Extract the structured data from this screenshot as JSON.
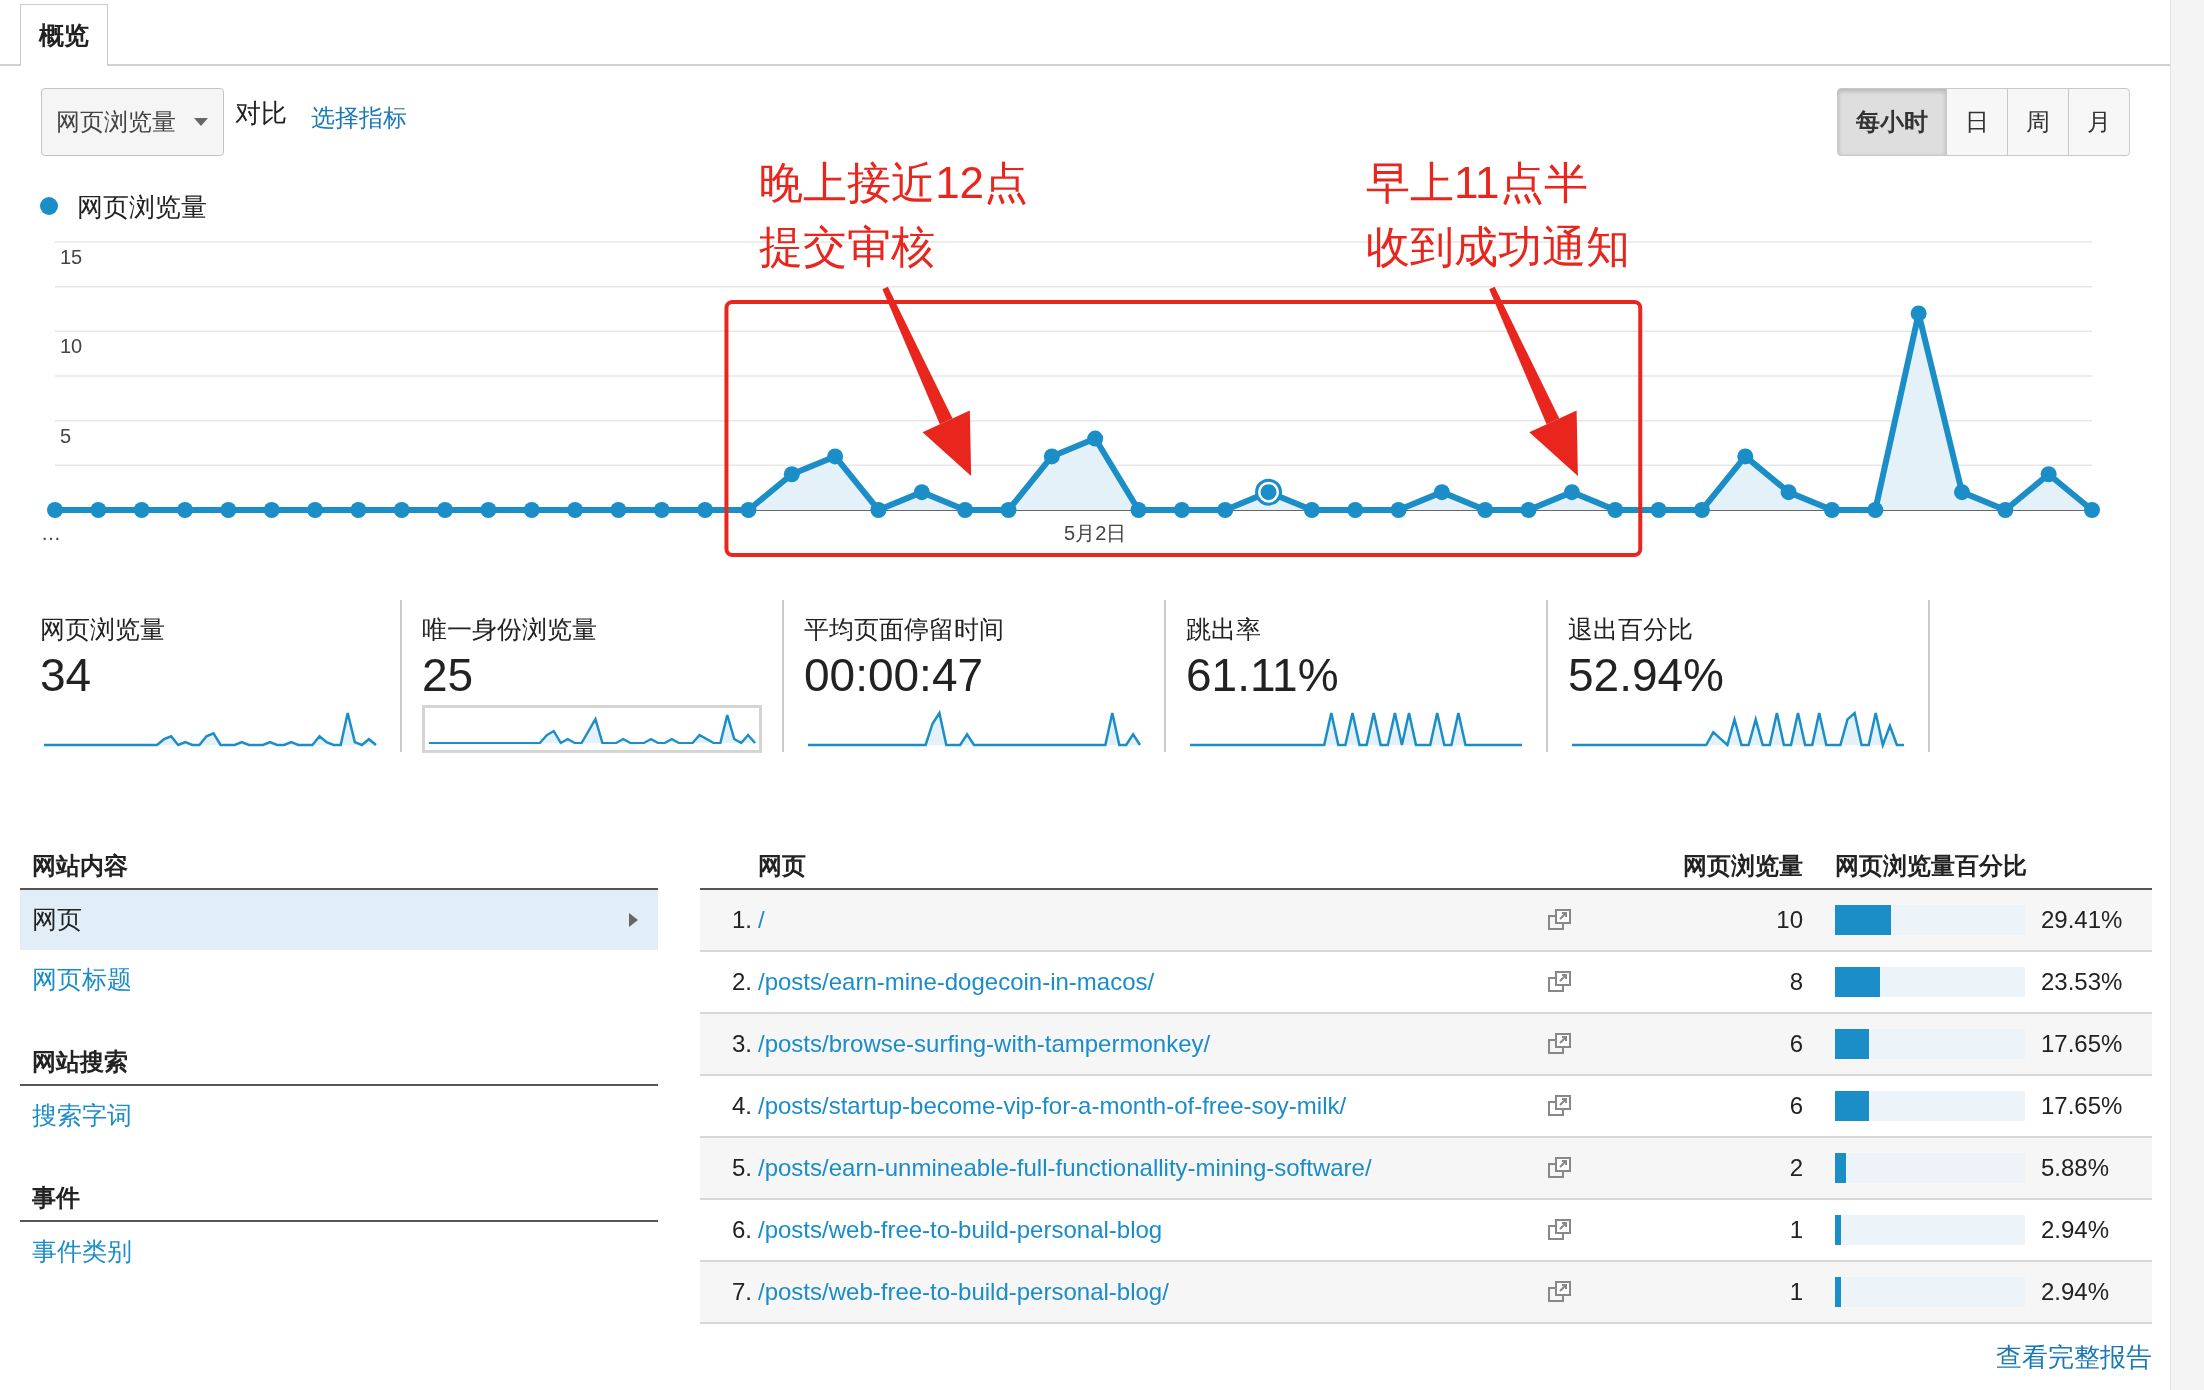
{
  "tabs": [
    {
      "label": "概览",
      "selected": true
    }
  ],
  "controls": {
    "metric_dropdown": "网页浏览量",
    "compare_label": "对比",
    "choose_metric_link": "选择指标",
    "granularity": [
      {
        "label": "每小时",
        "selected": true
      },
      {
        "label": "日",
        "selected": false
      },
      {
        "label": "周",
        "selected": false
      },
      {
        "label": "月",
        "selected": false
      }
    ]
  },
  "chart": {
    "chart_data": {
      "type": "area",
      "categories": [
        "…",
        null,
        null,
        null,
        null,
        null,
        null,
        null,
        null,
        null,
        null,
        null,
        null,
        null,
        null,
        null,
        null,
        null,
        null,
        null,
        null,
        null,
        null,
        null,
        "5月2日",
        null,
        null,
        null,
        null,
        null,
        null,
        null,
        null,
        null,
        null,
        null,
        null,
        null,
        null,
        null,
        null,
        null,
        null,
        null,
        null,
        null,
        null,
        null
      ],
      "series": [
        {
          "name": "网页浏览量",
          "color": "#1b8ec7",
          "values": [
            0,
            0,
            0,
            0,
            0,
            0,
            0,
            0,
            0,
            0,
            0,
            0,
            0,
            0,
            0,
            0,
            0,
            2,
            3,
            0,
            1,
            0,
            0,
            3,
            4,
            0,
            0,
            0,
            1,
            0,
            0,
            0,
            1,
            0,
            0,
            1,
            0,
            0,
            0,
            3,
            1,
            0,
            0,
            11,
            1,
            0,
            2,
            0
          ]
        }
      ],
      "ylim": [
        0,
        15
      ],
      "yticks": [
        5,
        10,
        15
      ]
    },
    "overlays": [
      {
        "kind": "marker"
      },
      {
        "kind": "box"
      },
      {
        "kind": "callout",
        "lines": [
          "晚上接近12点",
          "提交审核"
        ]
      },
      {
        "kind": "callout",
        "lines": [
          "早上11点半",
          "收到成功通知"
        ]
      }
    ]
  },
  "metrics": [
    {
      "label": "网页浏览量",
      "value": "34",
      "selected": false
    },
    {
      "label": "唯一身份浏览量",
      "value": "25",
      "selected": true
    },
    {
      "label": "平均页面停留时间",
      "value": "00:00:47",
      "selected": false
    },
    {
      "label": "跳出率",
      "value": "61.11%",
      "selected": false
    },
    {
      "label": "退出百分比",
      "value": "52.94%",
      "selected": false
    }
  ],
  "sidebar": {
    "sections": [
      {
        "heading": "网站内容",
        "items": [
          {
            "label": "网页",
            "selected": true
          },
          {
            "label": "网页标题",
            "selected": false
          }
        ]
      },
      {
        "heading": "网站搜索",
        "items": [
          {
            "label": "搜索字词",
            "selected": false
          }
        ]
      },
      {
        "heading": "事件",
        "items": [
          {
            "label": "事件类别",
            "selected": false
          }
        ]
      }
    ]
  },
  "table": {
    "columns": [
      "网页",
      "网页浏览量",
      "网页浏览量百分比"
    ],
    "rows": [
      {
        "index": "1.",
        "page": "/",
        "views": "10",
        "percent": "29.41%",
        "level": 0.2941
      },
      {
        "index": "2.",
        "page": "/posts/earn-mine-dogecoin-in-macos/",
        "views": "8",
        "percent": "23.53%",
        "level": 0.2353
      },
      {
        "index": "3.",
        "page": "/posts/browse-surfing-with-tampermonkey/",
        "views": "6",
        "percent": "17.65%",
        "level": 0.1765
      },
      {
        "index": "4.",
        "page": "/posts/startup-become-vip-for-a-month-of-free-soy-milk/",
        "views": "6",
        "percent": "17.65%",
        "level": 0.1765
      },
      {
        "index": "5.",
        "page": "/posts/earn-unmineable-full-functionallity-mining-software/",
        "views": "2",
        "percent": "5.88%",
        "level": 0.0588
      },
      {
        "index": "6.",
        "page": "/posts/web-free-to-build-personal-blog",
        "views": "1",
        "percent": "2.94%",
        "level": 0.0294
      },
      {
        "index": "7.",
        "page": "/posts/web-free-to-build-personal-blog/",
        "views": "1",
        "percent": "2.94%",
        "level": 0.0294
      }
    ],
    "footer_link": "查看完整报告"
  }
}
